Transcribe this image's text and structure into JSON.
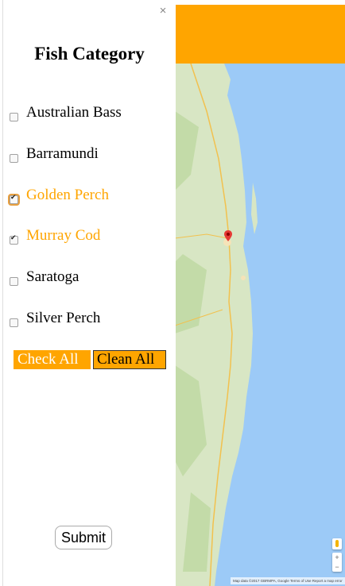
{
  "panel": {
    "title": "Fish Category",
    "close_label": "×"
  },
  "fish": [
    {
      "label": "Australian Bass",
      "checked": false,
      "selected": false
    },
    {
      "label": "Barramundi",
      "checked": false,
      "selected": false
    },
    {
      "label": "Golden Perch",
      "checked": true,
      "selected": true,
      "focused": true
    },
    {
      "label": "Murray Cod",
      "checked": true,
      "selected": true
    },
    {
      "label": "Saratoga",
      "checked": false,
      "selected": false
    },
    {
      "label": "Silver Perch",
      "checked": false,
      "selected": false
    }
  ],
  "buttons": {
    "check_all": "Check All",
    "clean_all": "Clean All",
    "submit": "Submit"
  },
  "map": {
    "footer": "Map data ©2017 GBRMPA, Google   Terms of Use   Report a map error",
    "zoom_in": "+",
    "zoom_out": "−"
  },
  "colors": {
    "accent": "#ffa500",
    "water": "#9ccaf7",
    "land": "#d8e6c4"
  }
}
